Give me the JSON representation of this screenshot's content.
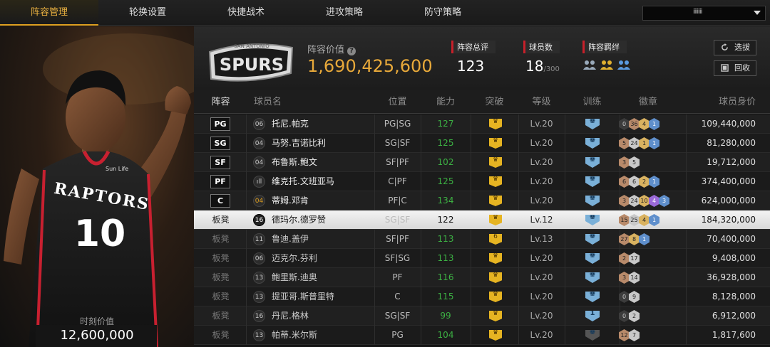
{
  "nav": {
    "tabs": [
      "阵容管理",
      "轮换设置",
      "快捷战术",
      "进攻策略",
      "防守策略"
    ],
    "active_index": 0,
    "dropdown_value": "iiiiiii"
  },
  "left_panel": {
    "jersey_team": "RAPTORS",
    "jersey_number": "10",
    "sponsor": "Sun Life",
    "moment_label": "时刻价值",
    "moment_value": "12,600,000"
  },
  "header": {
    "logo_text": "SPURS",
    "logo_top_text": "SAN ANTONIO",
    "value_label": "阵容价值",
    "help_icon": "?",
    "value": "1,690,425,600",
    "stats": {
      "overall_label": "阵容总评",
      "overall_value": "123",
      "count_label": "球员数",
      "count_value": "18",
      "count_max": "/300",
      "bond_label": "阵容羁绊"
    },
    "buttons": {
      "pick": "选拔",
      "recycle": "回收"
    }
  },
  "table": {
    "headers": [
      "阵容",
      "球员名",
      "位置",
      "能力",
      "突破",
      "等级",
      "训练",
      "徽章",
      "球员身价"
    ],
    "rows": [
      {
        "slot": "PG",
        "bench": false,
        "num": "06",
        "num_style": "normal",
        "name": "托尼.帕克",
        "pos": "PG|SG",
        "ability": "127",
        "crown": "",
        "level": "Lv.20",
        "train": "",
        "train_style": "blue",
        "badges": [
          [
            "black",
            "0"
          ],
          [
            "bronze",
            "36"
          ],
          [
            "gold",
            "4"
          ],
          [
            "blue",
            "1"
          ]
        ],
        "salary": "109,440,000"
      },
      {
        "slot": "SG",
        "bench": false,
        "num": "04",
        "num_style": "normal",
        "name": "马努.吉诺比利",
        "pos": "SG|SF",
        "ability": "125",
        "crown": "",
        "level": "Lv.20",
        "train": "",
        "train_style": "blue",
        "badges": [
          [
            "bronze",
            "5"
          ],
          [
            "silver",
            "24"
          ],
          [
            "gold",
            "1"
          ],
          [
            "blue",
            "1"
          ]
        ],
        "salary": "81,280,000"
      },
      {
        "slot": "SF",
        "bench": false,
        "num": "04",
        "num_style": "normal",
        "name": "布鲁斯.鲍文",
        "pos": "SF|PF",
        "ability": "102",
        "crown": "",
        "level": "Lv.20",
        "train": "",
        "train_style": "blue",
        "badges": [
          [
            "bronze",
            "3"
          ],
          [
            "silver",
            "5"
          ]
        ],
        "salary": "19,712,000"
      },
      {
        "slot": "PF",
        "bench": false,
        "num": "ıll",
        "num_style": "normal",
        "name": "维克托.文班亚马",
        "pos": "C|PF",
        "ability": "125",
        "crown": "",
        "level": "Lv.20",
        "train": "",
        "train_style": "blue",
        "badges": [
          [
            "bronze",
            "6"
          ],
          [
            "silver",
            "6"
          ],
          [
            "gold",
            "2"
          ],
          [
            "blue",
            "1"
          ]
        ],
        "salary": "374,400,000"
      },
      {
        "slot": "C",
        "bench": false,
        "num": "04",
        "num_style": "gold",
        "name": "蒂姆.邓肯",
        "pos": "PF|C",
        "ability": "134",
        "crown": "",
        "level": "Lv.20",
        "train": "",
        "train_style": "blue",
        "badges": [
          [
            "bronze",
            "3"
          ],
          [
            "silver",
            "24"
          ],
          [
            "gold",
            "10"
          ],
          [
            "purple",
            "4"
          ],
          [
            "blue",
            "3"
          ]
        ],
        "salary": "624,000,000"
      },
      {
        "slot": "板凳",
        "bench": true,
        "num": "16",
        "num_style": "dark",
        "name": "德玛尔.德罗赞",
        "pos": "SG|SF",
        "ability": "122",
        "crown": "",
        "level": "Lv.12",
        "train": "",
        "train_style": "blue",
        "badges": [
          [
            "bronze",
            "15"
          ],
          [
            "silver",
            "25"
          ],
          [
            "gold",
            "4"
          ],
          [
            "blue",
            "1"
          ]
        ],
        "salary": "184,320,000"
      },
      {
        "slot": "板凳",
        "bench": true,
        "num": "11",
        "num_style": "normal",
        "name": "鲁迪.盖伊",
        "pos": "SF|PF",
        "ability": "113",
        "crown": "6",
        "level": "Lv.13",
        "train": "",
        "train_style": "blue",
        "badges": [
          [
            "bronze",
            "27"
          ],
          [
            "gold",
            "8"
          ],
          [
            "blue",
            "1"
          ]
        ],
        "salary": "70,400,000"
      },
      {
        "slot": "板凳",
        "bench": true,
        "num": "06",
        "num_style": "normal",
        "name": "迈克尔.芬利",
        "pos": "SF|SG",
        "ability": "113",
        "crown": "",
        "level": "Lv.20",
        "train": "",
        "train_style": "blue",
        "badges": [
          [
            "bronze",
            "2"
          ],
          [
            "silver",
            "17"
          ]
        ],
        "salary": "9,408,000"
      },
      {
        "slot": "板凳",
        "bench": true,
        "num": "13",
        "num_style": "normal",
        "name": "鲍里斯.迪奥",
        "pos": "PF",
        "ability": "116",
        "crown": "",
        "level": "Lv.20",
        "train": "",
        "train_style": "blue",
        "badges": [
          [
            "bronze",
            "3"
          ],
          [
            "silver",
            "14"
          ]
        ],
        "salary": "36,928,000"
      },
      {
        "slot": "板凳",
        "bench": true,
        "num": "13",
        "num_style": "normal",
        "name": "提亚哥.斯普里特",
        "pos": "C",
        "ability": "115",
        "crown": "",
        "level": "Lv.20",
        "train": "",
        "train_style": "blue",
        "badges": [
          [
            "black",
            "0"
          ],
          [
            "silver",
            "9"
          ]
        ],
        "salary": "8,128,000"
      },
      {
        "slot": "板凳",
        "bench": true,
        "num": "16",
        "num_style": "normal",
        "name": "丹尼.格林",
        "pos": "SG|SF",
        "ability": "99",
        "crown": "",
        "level": "Lv.20",
        "train": "1",
        "train_style": "blue",
        "badges": [
          [
            "black",
            "0"
          ],
          [
            "silver",
            "2"
          ]
        ],
        "salary": "6,912,000"
      },
      {
        "slot": "板凳",
        "bench": true,
        "num": "13",
        "num_style": "normal",
        "name": "帕蒂.米尔斯",
        "pos": "PG",
        "ability": "104",
        "crown": "",
        "level": "Lv.20",
        "train": "",
        "train_style": "dark",
        "badges": [
          [
            "bronze",
            "12"
          ],
          [
            "silver",
            "7"
          ]
        ],
        "salary": "1,817,600"
      }
    ],
    "selected_index": 5
  }
}
